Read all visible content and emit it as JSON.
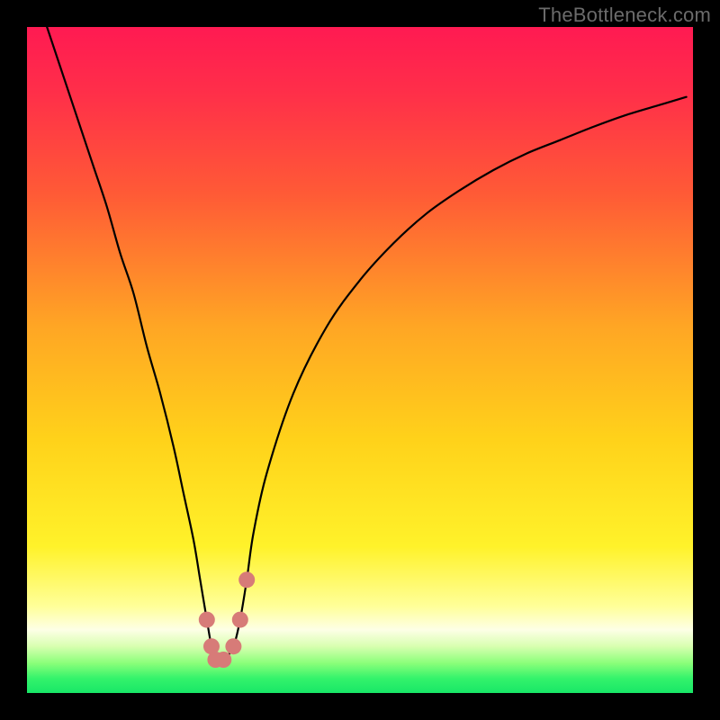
{
  "watermark": "TheBottleneck.com",
  "colors": {
    "black": "#000000",
    "curve": "#000000",
    "marker": "#d77b78",
    "gradient_stops": [
      {
        "offset": 0.0,
        "color": "#ff1a52"
      },
      {
        "offset": 0.1,
        "color": "#ff2f49"
      },
      {
        "offset": 0.25,
        "color": "#ff5a36"
      },
      {
        "offset": 0.45,
        "color": "#ffa624"
      },
      {
        "offset": 0.62,
        "color": "#ffd21a"
      },
      {
        "offset": 0.78,
        "color": "#fff22a"
      },
      {
        "offset": 0.87,
        "color": "#ffff99"
      },
      {
        "offset": 0.905,
        "color": "#fdffe6"
      },
      {
        "offset": 0.93,
        "color": "#d8ffb0"
      },
      {
        "offset": 0.955,
        "color": "#8bff7a"
      },
      {
        "offset": 0.978,
        "color": "#34f36b"
      },
      {
        "offset": 1.0,
        "color": "#18e767"
      }
    ]
  },
  "chart_data": {
    "type": "line",
    "title": "",
    "xlabel": "",
    "ylabel": "",
    "xlim": [
      0,
      100
    ],
    "ylim": [
      0,
      100
    ],
    "series": [
      {
        "name": "bottleneck-curve",
        "x": [
          3,
          5,
          8,
          10,
          12,
          14,
          16,
          18,
          20,
          22,
          23.5,
          25,
          26,
          27,
          27.7,
          28.3,
          29.5,
          31,
          32,
          33,
          34,
          36,
          40,
          45,
          50,
          55,
          60,
          65,
          70,
          75,
          80,
          85,
          90,
          95,
          99
        ],
        "y": [
          100,
          94,
          85,
          79,
          73,
          66,
          60,
          52,
          45,
          37,
          30,
          23,
          17,
          11,
          7,
          5,
          5,
          7,
          11,
          17,
          24,
          33,
          45,
          55,
          62,
          67.5,
          72,
          75.5,
          78.5,
          81,
          83,
          85,
          86.8,
          88.3,
          89.5
        ]
      }
    ],
    "markers": {
      "name": "highlighted-points",
      "points": [
        {
          "x": 27.0,
          "y": 11.0
        },
        {
          "x": 27.7,
          "y": 7.0
        },
        {
          "x": 28.3,
          "y": 5.0
        },
        {
          "x": 29.5,
          "y": 5.0
        },
        {
          "x": 31.0,
          "y": 7.0
        },
        {
          "x": 32.0,
          "y": 11.0
        },
        {
          "x": 33.0,
          "y": 17.0
        }
      ]
    },
    "grid": false,
    "legend": false
  }
}
